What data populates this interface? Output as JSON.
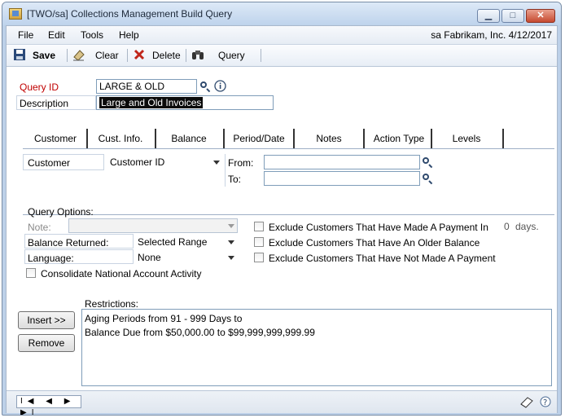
{
  "window": {
    "title": "[TWO/sa] Collections Management Build Query"
  },
  "menu": {
    "items": [
      "File",
      "Edit",
      "Tools",
      "Help"
    ],
    "context": "sa  Fabrikam, Inc.  4/12/2017"
  },
  "toolbar": {
    "save": "Save",
    "clear": "Clear",
    "delete": "Delete",
    "query": "Query"
  },
  "header": {
    "query_id_label": "Query ID",
    "query_id_value": "LARGE & OLD",
    "description_label": "Description",
    "description_value": "Large and Old Invoices"
  },
  "tabs": [
    "Customer",
    "Cust. Info.",
    "Balance",
    "Period/Date",
    "Notes",
    "Action Type",
    "Levels"
  ],
  "customer_tab": {
    "label": "Customer",
    "field_select": "Customer ID",
    "from_label": "From:",
    "to_label": "To:",
    "from_value": "",
    "to_value": ""
  },
  "query_options": {
    "title": "Query Options:",
    "note_label": "Note:",
    "note_value": "",
    "balance_label": "Balance Returned:",
    "balance_value": "Selected Range",
    "language_label": "Language:",
    "language_value": "None",
    "consolidate_label": "Consolidate National Account Activity",
    "exclude_payment_in": "Exclude Customers That Have Made A Payment In",
    "days_value": "0",
    "days_label": "days.",
    "exclude_older": "Exclude Customers That Have An Older Balance",
    "exclude_not_paid": "Exclude Customers That Have Not Made A Payment"
  },
  "restrictions": {
    "label": "Restrictions:",
    "insert_button": "Insert >>",
    "remove_button": "Remove",
    "lines": [
      "Aging Periods from 91 - 999 Days to",
      "Balance Due from $50,000.00 to $99,999,999,999.99"
    ]
  },
  "status": {
    "nav": "I◀ ◀ ▶ ▶I"
  },
  "colors": {
    "required_label": "#c00000",
    "window_frame": "#bcd0e8",
    "close_button": "#c64a30"
  }
}
